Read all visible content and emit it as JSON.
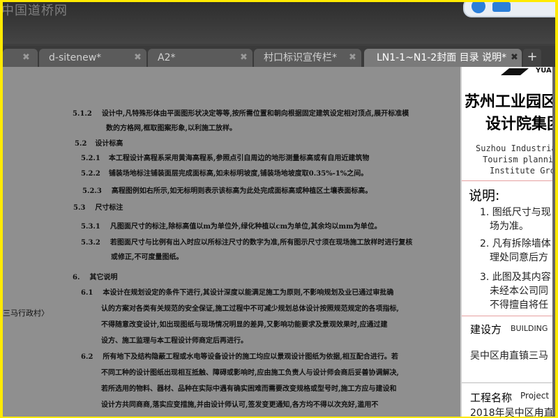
{
  "watermark": "中国道桥网",
  "tabs": [
    {
      "label": "",
      "close": "✖"
    },
    {
      "label": "d-sitenew*",
      "close": "✖"
    },
    {
      "label": "A2*",
      "close": "✖"
    },
    {
      "label": "村口标识宣传栏*",
      "close": "✖"
    },
    {
      "label": "LN1-1~N1-2封面 目录 说明*",
      "close": "✖",
      "active": true
    }
  ],
  "add_tab": "+",
  "notes": [
    {
      "num": "5.1.2",
      "text": "设计中,凡特殊形体由平面图形状决定等等,按所需位置和朝向根据固定建筑设定相对顶点,展开标准模"
    },
    {
      "num": "",
      "text": "数的方格网,框取图案形象,以利施工放样。"
    },
    {
      "num": "5.2",
      "text": "设计标高"
    },
    {
      "num": "5.2.1",
      "text": "本工程设计高程系采用黄海高程系,参照点引自周边的地形测量标高或有自用近建筑物"
    },
    {
      "num": "5.2.2",
      "text": "铺装场地标注铺装面层完成面标高,如未标明坡度,铺装场地坡度取0.35%-1%之间。"
    },
    {
      "num": "5.2.3",
      "text": "高程图例如右所示,如无标明则表示该标高为此处完成面标高或种植区土壤表面标高。"
    },
    {
      "num": "5.3",
      "text": "尺寸标注"
    },
    {
      "num": "5.3.1",
      "text": "凡图面尺寸的标注,除标高值以m为单位外,绿化种植以cm为单位,其余均以mm为单位。"
    },
    {
      "num": "5.3.2",
      "text": "若图面尺寸与比例有出入时应以所标注尺寸的数字为准,所有图示尺寸须在现场施工放样时进行复核"
    },
    {
      "num": "",
      "text": "或修正,不可度量图纸。"
    },
    {
      "num": "6.",
      "text": "其它说明"
    },
    {
      "num": "6.1",
      "text": "本设计在规划设定的条件下进行,其设计深度以能满足施工为原则,不影响规划及业已通过审批确"
    },
    {
      "num": "",
      "text": "认的方案对各类有关规范的安全保证,施工过程中不可减少规划总体设计按照规范规定的各项指标,"
    },
    {
      "num": "",
      "text": "不得随意改变设计,如出现图纸与现场情况明显的差异,又影响功能要求及景观效果时,应通过建"
    },
    {
      "num": "",
      "text": "设方、施工监理与本工程设计师商定后再进行。"
    },
    {
      "num": "6.2",
      "text": "所有地下及结构隐蔽工程或水电等设备设计的施工均应以景观设计图纸为依据,相互配合进行。若"
    },
    {
      "num": "",
      "text": "不同工种的设计图纸出现相互抵触、障碍或影响时,应由施工负责人与设计师会商后妥善协调解决,"
    },
    {
      "num": "",
      "text": "若所选用的物料、器材、品种在实际中遇有确实困难而需要改变规格或型号时,施工方应与建设和"
    },
    {
      "num": "",
      "text": "设计方共同商商,落实应变措施,并由设计师认可,签发变更通知,各方均不得以次充好,滥用不"
    }
  ],
  "left_fragment": "三马行政村〉",
  "title_block": {
    "logo_text": "YUA",
    "company_cn_1": "苏州工业园区",
    "company_cn_2": "设计院集团",
    "company_en_1": "Suzhou Industria",
    "company_en_2": "Tourism plannin",
    "company_en_3": "Institute Gro",
    "notes_heading": "说明:",
    "notes": [
      "1. 图纸尺寸与现",
      "场为准。",
      "2. 凡有拆除墙体",
      "理处同意后方",
      "3. 此图及其内容",
      "未经本公司同",
      "不得擅自将任"
    ],
    "builder_label": "建设方",
    "builder_label_en": "BUILDING",
    "builder_value": "吴中区甪直镇三马",
    "project_label": "工程名称",
    "project_label_en": "Project",
    "project_value": "2018年吴中区甪直"
  }
}
